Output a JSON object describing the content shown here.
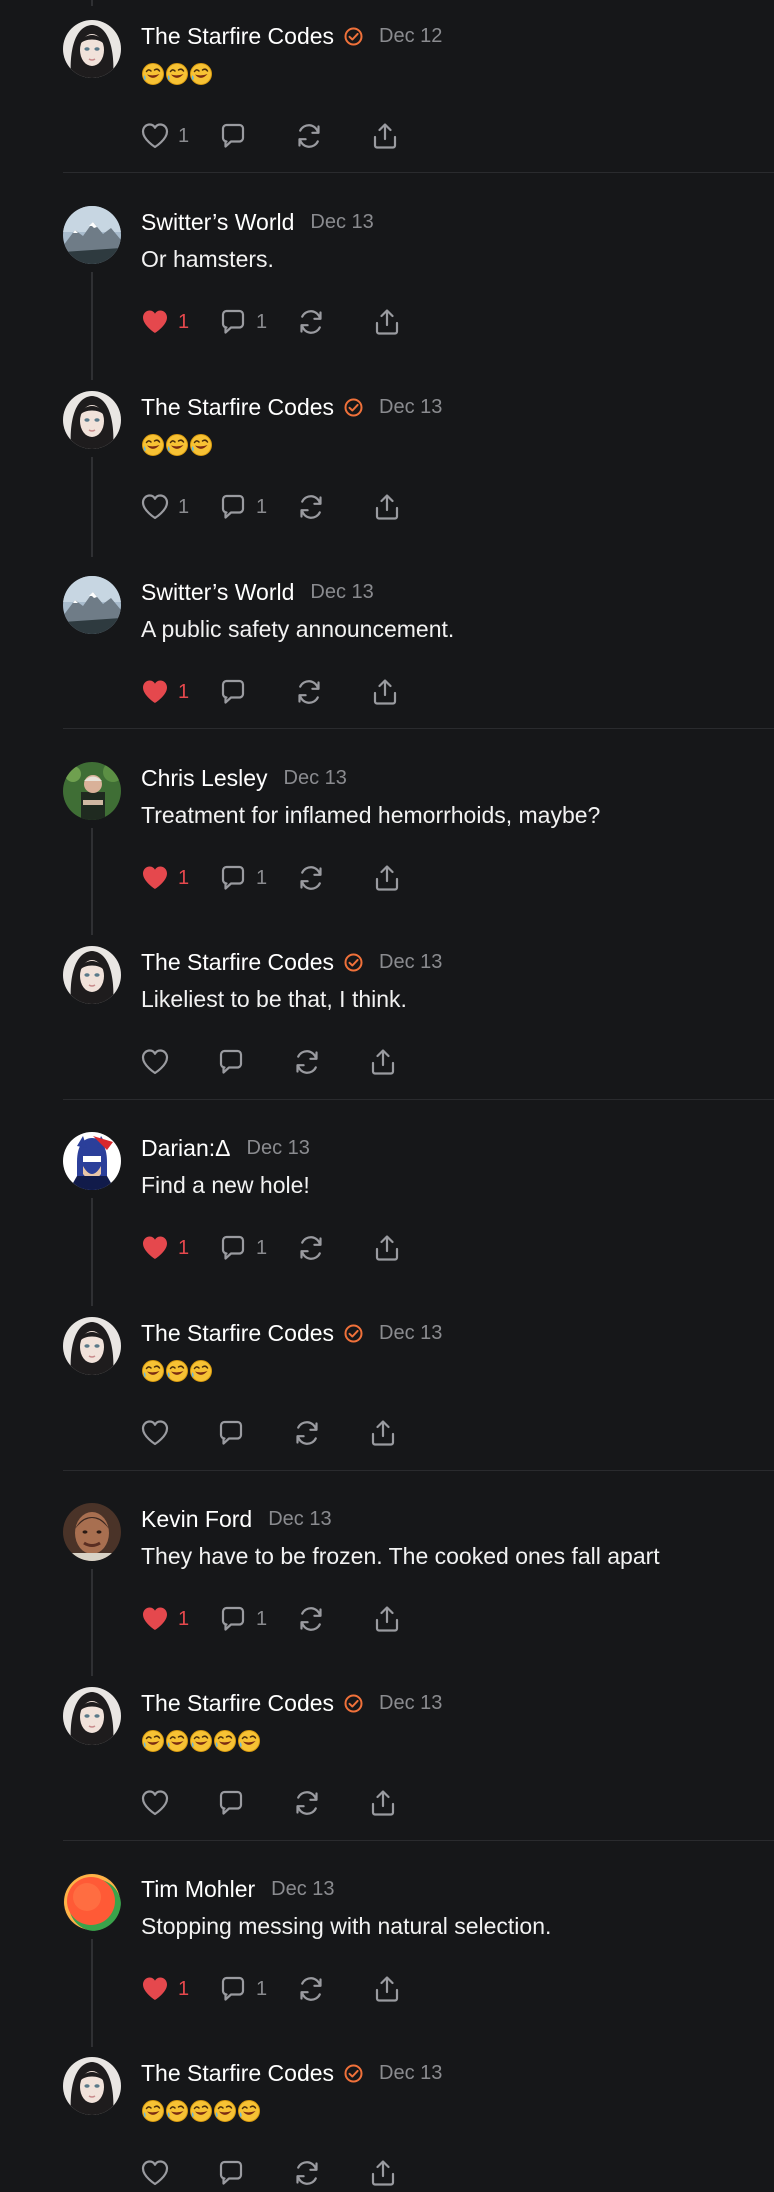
{
  "posts": [
    {
      "author": "The Starfire Codes",
      "verified": true,
      "date": "Dec 12",
      "text": "",
      "emojis": 3,
      "liked": false,
      "likes": "1",
      "replies": "",
      "avatar": "starfire-avatar"
    },
    {
      "author": "Switter’s World",
      "verified": false,
      "date": "Dec 13",
      "text": "Or hamsters.",
      "emojis": 0,
      "liked": true,
      "likes": "1",
      "replies": "1",
      "avatar": "mountain-avatar"
    },
    {
      "author": "The Starfire Codes",
      "verified": true,
      "date": "Dec 13",
      "text": "",
      "emojis": 3,
      "liked": false,
      "likes": "1",
      "replies": "1",
      "avatar": "starfire-avatar"
    },
    {
      "author": "Switter’s World",
      "verified": false,
      "date": "Dec 13",
      "text": "A public safety announcement.",
      "emojis": 0,
      "liked": true,
      "likes": "1",
      "replies": "",
      "avatar": "mountain-avatar"
    },
    {
      "author": "Chris Lesley",
      "verified": false,
      "date": "Dec 13",
      "text": "Treatment for inflamed hemorrhoids, maybe?",
      "emojis": 0,
      "liked": true,
      "likes": "1",
      "replies": "1",
      "avatar": "chris-avatar"
    },
    {
      "author": "The Starfire Codes",
      "verified": true,
      "date": "Dec 13",
      "text": "Likeliest to be that, I think.",
      "emojis": 0,
      "liked": false,
      "likes": "",
      "replies": "",
      "avatar": "starfire-avatar"
    },
    {
      "author": "Darian:Δ",
      "verified": false,
      "date": "Dec 13",
      "text": "Find a new hole!",
      "emojis": 0,
      "liked": true,
      "likes": "1",
      "replies": "1",
      "avatar": "darian-avatar"
    },
    {
      "author": "The Starfire Codes",
      "verified": true,
      "date": "Dec 13",
      "text": "",
      "emojis": 3,
      "liked": false,
      "likes": "",
      "replies": "",
      "avatar": "starfire-avatar"
    },
    {
      "author": "Kevin Ford",
      "verified": false,
      "date": "Dec 13",
      "text": "They have to be frozen. The cooked ones fall apart",
      "emojis": 0,
      "liked": true,
      "likes": "1",
      "replies": "1",
      "avatar": "kevin-avatar"
    },
    {
      "author": "The Starfire Codes",
      "verified": true,
      "date": "Dec 13",
      "text": "",
      "emojis": 5,
      "liked": false,
      "likes": "",
      "replies": "",
      "avatar": "starfire-avatar"
    },
    {
      "author": "Tim Mohler",
      "verified": false,
      "date": "Dec 13",
      "text": "Stopping messing with natural selection.",
      "emojis": 0,
      "liked": true,
      "likes": "1",
      "replies": "1",
      "avatar": "tim-avatar"
    },
    {
      "author": "The Starfire Codes",
      "verified": true,
      "date": "Dec 13",
      "text": "",
      "emojis": 5,
      "liked": false,
      "likes": "",
      "replies": "",
      "avatar": "starfire-avatar"
    }
  ],
  "colors": {
    "background": "#161719",
    "accent_verified": "#f0713a",
    "liked": "#e5484d",
    "muted": "#8a8b8f"
  }
}
